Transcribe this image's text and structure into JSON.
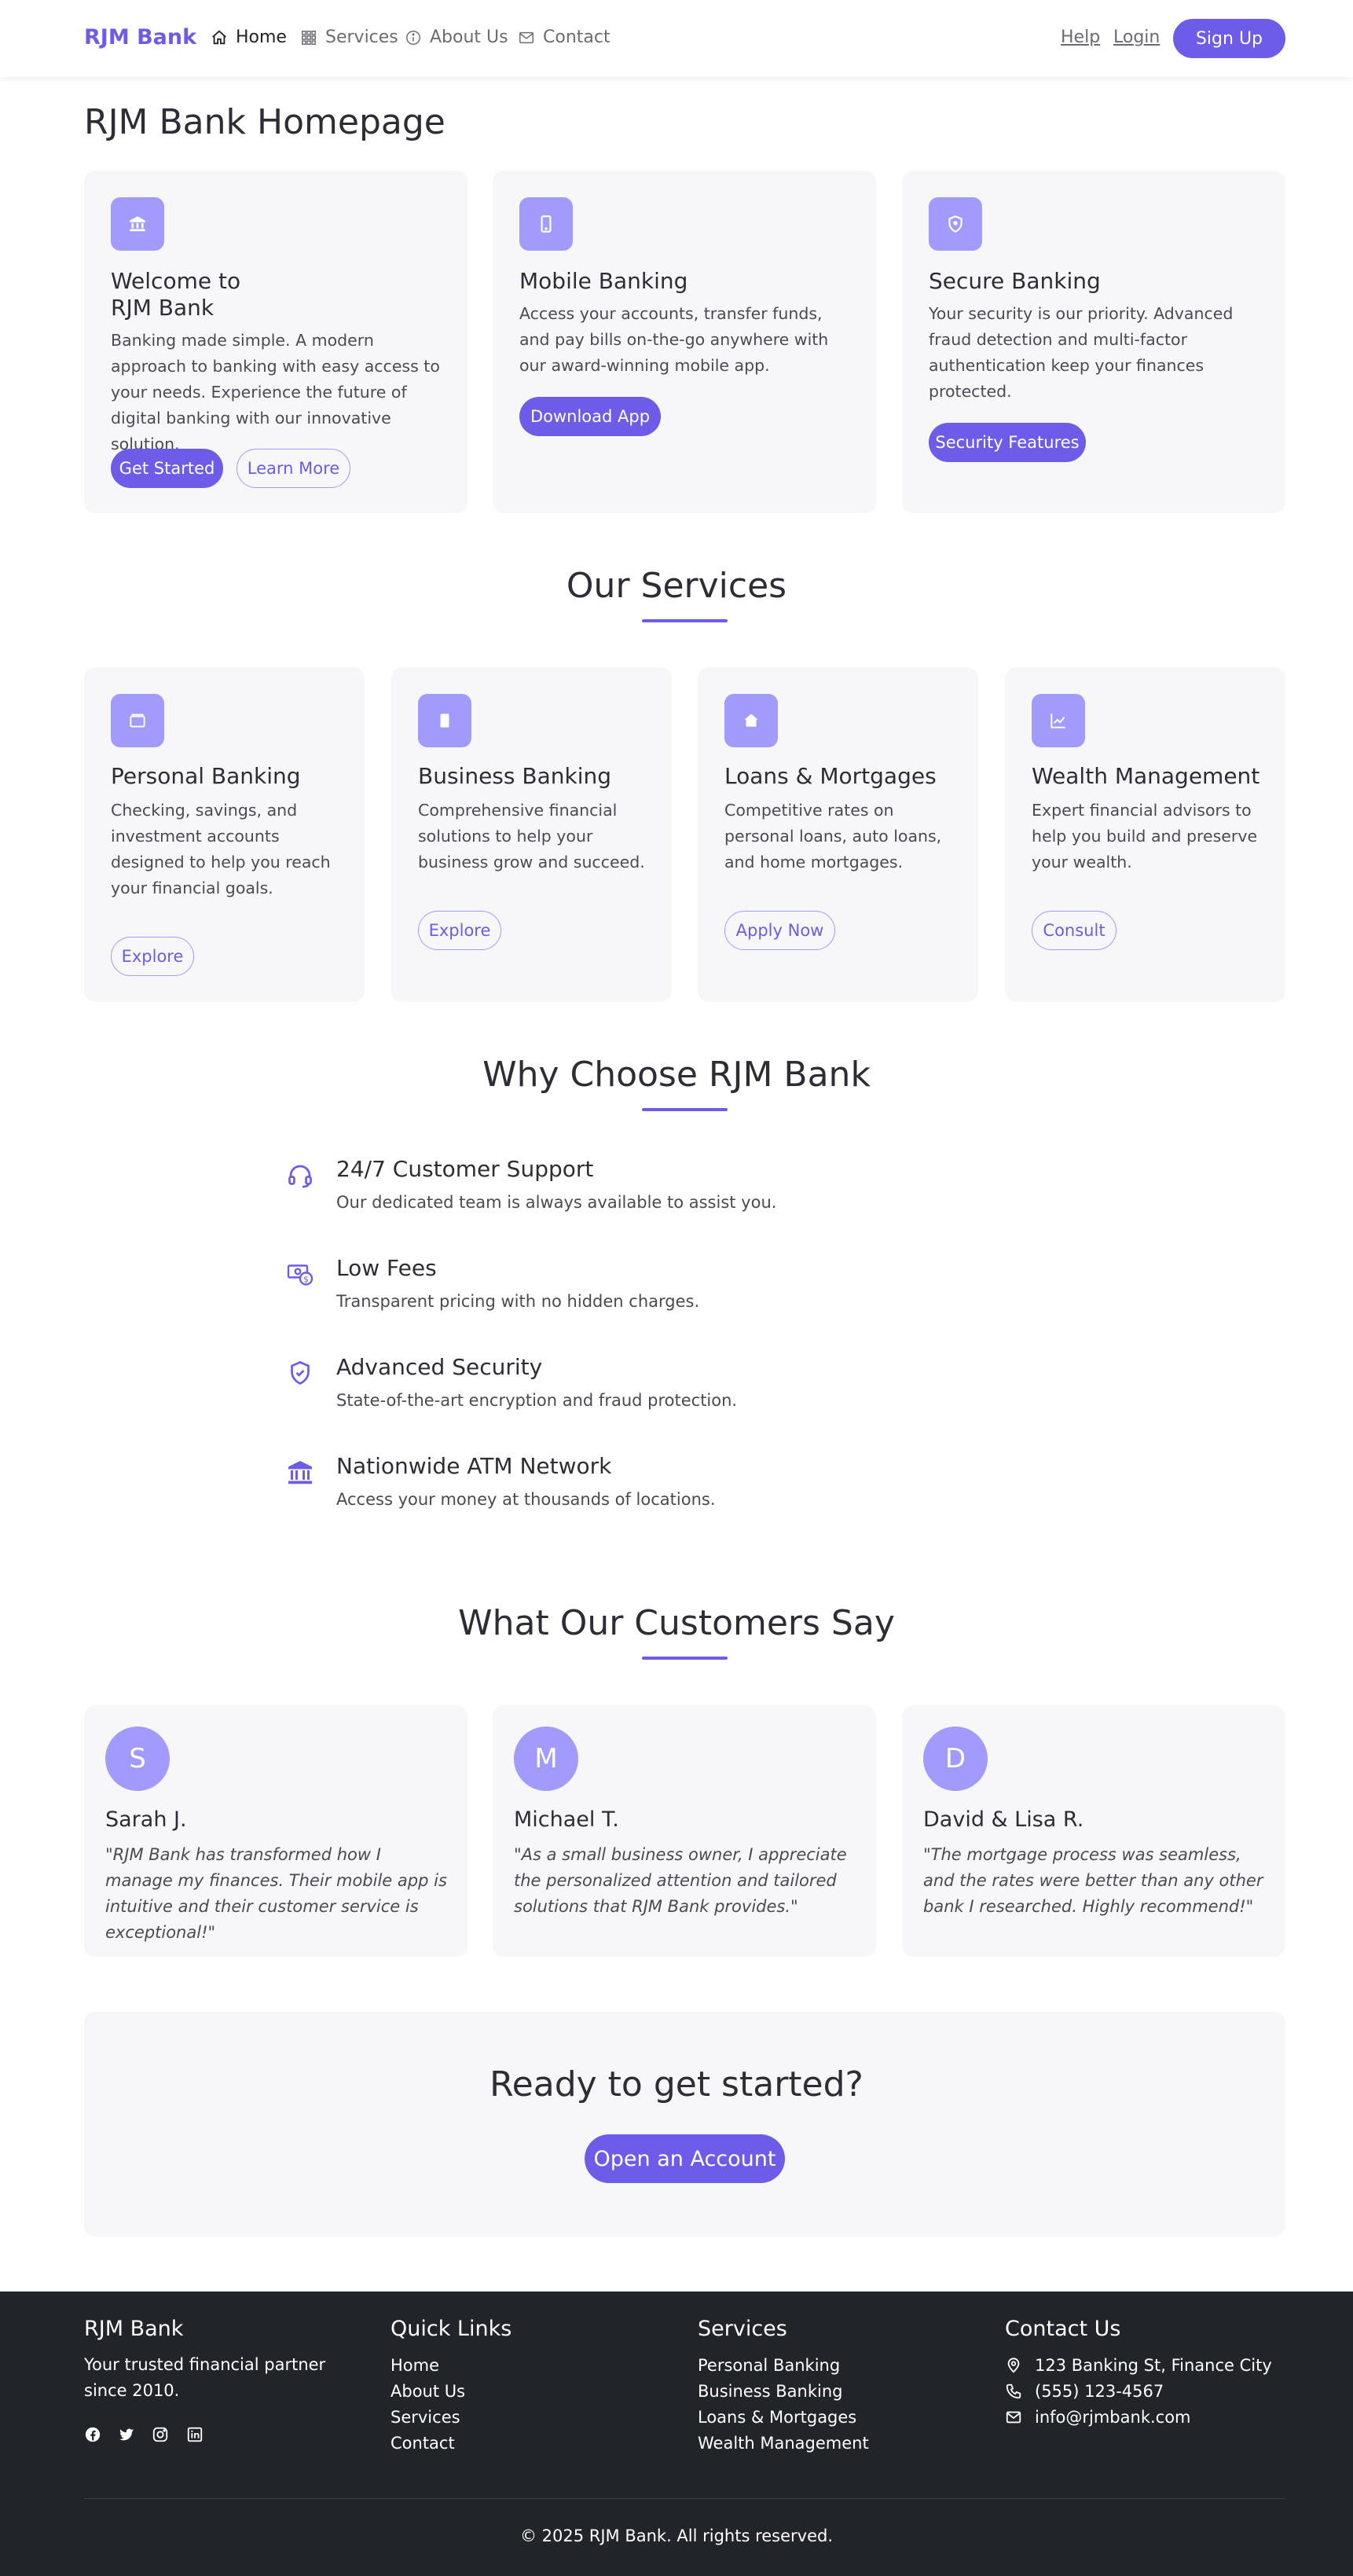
{
  "nav": {
    "brand": "RJM Bank",
    "links": [
      {
        "label": "Home",
        "icon": "home-icon"
      },
      {
        "label": "Services",
        "icon": "grid-icon"
      },
      {
        "label": "About Us",
        "icon": "info-icon"
      },
      {
        "label": "Contact",
        "icon": "mail-icon"
      }
    ],
    "help": "Help",
    "login": "Login",
    "signup": "Sign Up"
  },
  "page_title": "RJM Bank Homepage",
  "hero_cards": [
    {
      "icon": "bank-icon",
      "title_line1": "Welcome to",
      "title_line2": "RJM Bank",
      "text": "Banking made simple. A modern approach to banking with easy access to your needs. Experience the future of digital banking with our innovative solution.",
      "primary": "Get Started",
      "secondary": "Learn More"
    },
    {
      "icon": "mobile-icon",
      "title": "Mobile Banking",
      "text": "Access your accounts, transfer funds, and pay bills on-the-go anywhere with our award-winning mobile app.",
      "primary": "Download App"
    },
    {
      "icon": "shield-icon",
      "title": "Secure Banking",
      "text": "Your security is our priority. Advanced fraud detection and multi-factor authentication keep your finances protected.",
      "primary": "Security Features"
    }
  ],
  "services": {
    "title": "Our Services",
    "items": [
      {
        "icon": "wallet-icon",
        "title": "Personal Banking",
        "text": "Checking, savings, and investment accounts designed to help you reach your financial goals.",
        "button": "Explore"
      },
      {
        "icon": "building-icon",
        "title": "Business Banking",
        "text": "Comprehensive financial solutions to help your business grow and succeed.",
        "button": "Explore"
      },
      {
        "icon": "house-icon",
        "title": "Loans & Mortgages",
        "text": "Competitive rates on personal loans, auto loans, and home mortgages.",
        "button": "Apply Now"
      },
      {
        "icon": "chart-icon",
        "title": "Wealth Management",
        "text": "Expert financial advisors to help you build and preserve your wealth.",
        "button": "Consult"
      }
    ]
  },
  "why": {
    "title": "Why Choose RJM Bank",
    "items": [
      {
        "icon": "headset-icon",
        "title": "24/7 Customer Support",
        "text": "Our dedicated team is always available to assist you."
      },
      {
        "icon": "money-icon",
        "title": "Low Fees",
        "text": "Transparent pricing with no hidden charges."
      },
      {
        "icon": "shield-check-icon",
        "title": "Advanced Security",
        "text": "State-of-the-art encryption and fraud protection."
      },
      {
        "icon": "bank-icon",
        "title": "Nationwide ATM Network",
        "text": "Access your money at thousands of locations."
      }
    ]
  },
  "testimonials": {
    "title": "What Our Customers Say",
    "items": [
      {
        "initial": "S",
        "name": "Sarah J.",
        "quote": "\"RJM Bank has transformed how I manage my finances. Their mobile app is intuitive and their customer service is exceptional!\""
      },
      {
        "initial": "M",
        "name": "Michael T.",
        "quote": "\"As a small business owner, I appreciate the personalized attention and tailored solutions that RJM Bank provides.\""
      },
      {
        "initial": "D",
        "name": "David & Lisa R.",
        "quote": "\"The mortgage process was seamless, and the rates were better than any other bank I researched. Highly recommend!\""
      }
    ]
  },
  "cta": {
    "title": "Ready to get started?",
    "button": "Open an Account"
  },
  "footer": {
    "brand": "RJM Bank",
    "tagline": "Your trusted financial partner since 2010.",
    "social": [
      "facebook-icon",
      "twitter-icon",
      "instagram-icon",
      "linkedin-icon"
    ],
    "quick_links_title": "Quick Links",
    "quick_links": [
      "Home",
      "About Us",
      "Services",
      "Contact"
    ],
    "services_title": "Services",
    "services": [
      "Personal Banking",
      "Business Banking",
      "Loans & Mortgages",
      "Wealth Management"
    ],
    "contact_title": "Contact Us",
    "address": "123 Banking St, Finance City",
    "phone": "(555) 123-4567",
    "email": "info@rjmbank.com",
    "copyright": "© 2025 RJM Bank. All rights reserved."
  },
  "colors": {
    "accent": "#6c5ce7",
    "icon_bg": "#a29bfe",
    "card_bg": "#f7f7f9",
    "footer_bg": "#212429"
  }
}
